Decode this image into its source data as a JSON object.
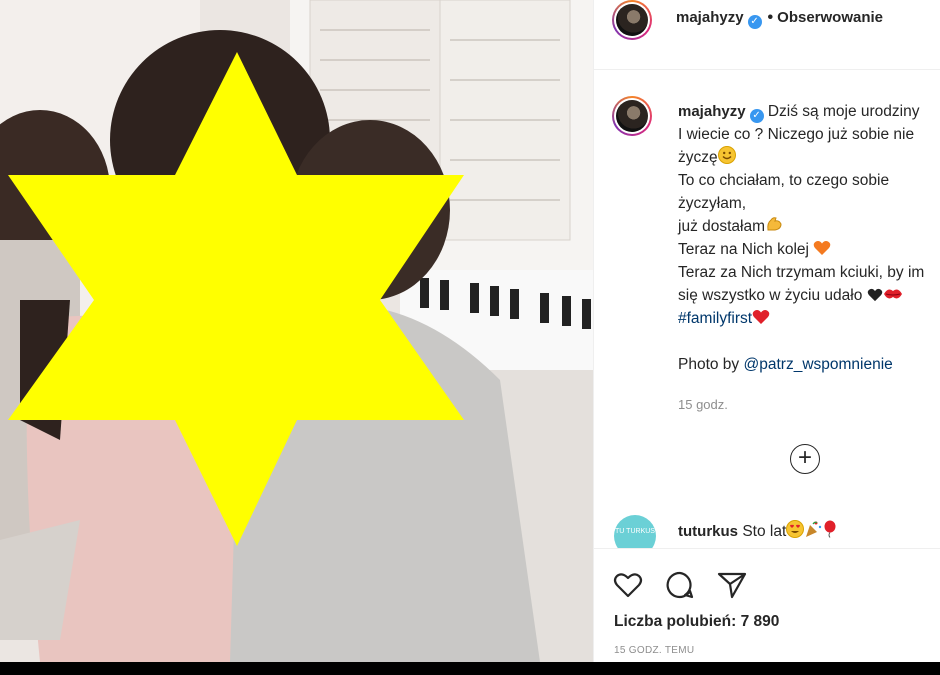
{
  "post": {
    "username": "majahyzy",
    "verified_mark": "✓",
    "follow_dot": "•",
    "follow_label": "Obserwowanie",
    "caption": {
      "l1": "Dziś są moje urodziny",
      "l2": "I wiecie co ? Niczego już sobie nie",
      "l3": "życzę",
      "l4": "To co chciałam, to czego sobie",
      "l5": "życzyłam,",
      "l6": "już dostałam",
      "l7": "Teraz na Nich kolej",
      "l8": "Teraz za Nich trzymam kciuki, by im",
      "l9": "się wszystko w życiu udało",
      "hashtag": "#familyfirst",
      "photo_prefix": "Photo by",
      "photo_credit": "@patrz_wspomnienie"
    },
    "caption_time": "15 godz.",
    "more_comments_symbol": "+",
    "comment": {
      "avatar_text": "TU TURKUS",
      "username": "tuturkus",
      "text": "Sto lat"
    },
    "likes_label": "Liczba polubień: 7 890",
    "time_ago": "15 godz. temu"
  },
  "icons": {
    "verified": "verified-badge-icon",
    "like": "heart-icon",
    "comment": "comment-bubble-icon",
    "share": "paper-plane-icon",
    "more": "plus-circle-icon"
  },
  "colors": {
    "verified_blue": "#3897f0",
    "star_yellow": "#ffff00",
    "link": "#00376b",
    "muted": "#8e8e8e",
    "comment_avatar": "#6bd0d6"
  }
}
